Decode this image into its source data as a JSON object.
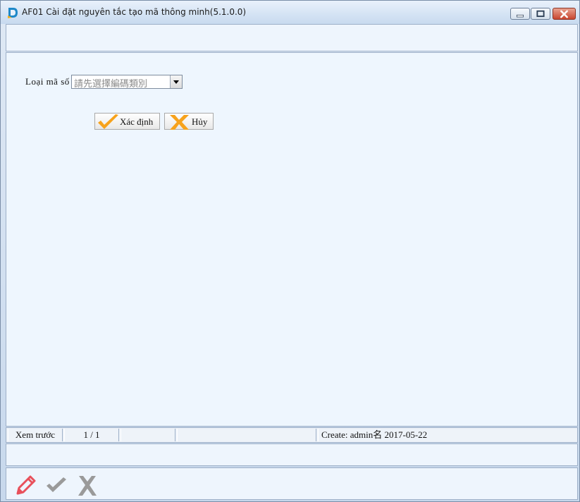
{
  "window": {
    "title": "AF01 Cài đặt nguyên tắc tạo mã thông minh(5.1.0.0)",
    "icon": "app-logo-icon"
  },
  "form": {
    "code_type_label": "Loại mã số",
    "code_type_value": "請先選擇編碼類別",
    "ok_label": "Xác định",
    "cancel_label": "Hủy"
  },
  "status": {
    "mode": "Xem trước",
    "page": "1 / 1",
    "seg3": "",
    "seg4": "",
    "created": "Create: admin名 2017-05-22"
  },
  "bottom_toolbar": {
    "icons": [
      "edit-pencil-icon",
      "confirm-check-icon",
      "cancel-x-icon"
    ]
  },
  "colors": {
    "accent_orange": "#f7a21b",
    "pencil_red": "#e8505b",
    "disabled_gray": "#9a9a9a",
    "panel_bg": "#eef6fe"
  }
}
